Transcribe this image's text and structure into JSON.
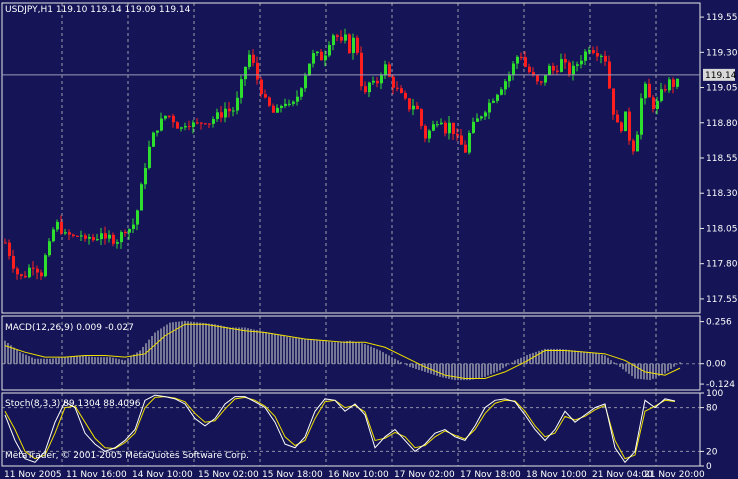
{
  "colors": {
    "background": "#141456",
    "frame": "#e8e8e8",
    "grid": "#c8c8c8",
    "bull": "#2ee02e",
    "bear": "#ff1e1e",
    "macd_hist": "#d8d8d8",
    "signal": "#f0e000",
    "stoch_main": "#ffffff",
    "stoch_signal": "#f0e000",
    "price_label_bg": "#d8d8d8",
    "price_label_text": "#000000"
  },
  "symbol_title": "USDJPY,H1  119.10 119.14 119.09 119.14",
  "current_price_label": "119.14",
  "macd_title": "MACD(12,26,9) 0.009 -0.027",
  "stoch_title": "Stoch(8,3,3) 89.1304 88.4096",
  "copyright": "MetaTrader, © 2001-2005 MetaQuotes Software Corp.",
  "price_ticks": [
    "119.55",
    "119.30",
    "119.05",
    "118.80",
    "118.55",
    "118.30",
    "118.05",
    "117.80",
    "117.55"
  ],
  "macd_ticks": [
    "0.256",
    "0.00",
    "-0.124"
  ],
  "stoch_ticks": [
    "100",
    "80",
    "20",
    "0"
  ],
  "time_labels": [
    "11 Nov 2005",
    "11 Nov 16:00",
    "14 Nov 10:00",
    "15 Nov 02:00",
    "15 Nov 18:00",
    "16 Nov 10:00",
    "17 Nov 02:00",
    "17 Nov 18:00",
    "18 Nov 10:00",
    "21 Nov 04:00",
    "21 Nov 20:00"
  ],
  "chart_data": {
    "type": "candlestick",
    "symbol": "USDJPY",
    "timeframe": "H1",
    "last_bar": {
      "open": 119.1,
      "high": 119.14,
      "low": 119.09,
      "close": 119.14
    },
    "price_range": [
      117.45,
      119.65
    ],
    "macd": {
      "fast": 12,
      "slow": 26,
      "signal": 9,
      "main": 0.009,
      "signal_value": -0.027,
      "range": [
        -0.16,
        0.29
      ]
    },
    "stochastic": {
      "k": 8,
      "d": 3,
      "slowing": 3,
      "main": 89.1304,
      "signal": 88.4096,
      "levels": [
        80,
        20
      ],
      "range": [
        0,
        100
      ]
    },
    "price_path": [
      [
        0,
        117.95
      ],
      [
        5,
        117.85
      ],
      [
        10,
        117.75
      ],
      [
        15,
        117.7
      ],
      [
        20,
        117.72
      ],
      [
        25,
        117.78
      ],
      [
        30,
        117.8
      ],
      [
        35,
        117.7
      ],
      [
        40,
        117.85
      ],
      [
        45,
        117.95
      ],
      [
        50,
        118.1
      ],
      [
        55,
        118.05
      ],
      [
        60,
        118.0
      ],
      [
        65,
        118.0
      ],
      [
        70,
        117.98
      ],
      [
        75,
        118.02
      ],
      [
        80,
        117.95
      ],
      [
        85,
        118.0
      ],
      [
        90,
        117.95
      ],
      [
        95,
        118.05
      ],
      [
        100,
        117.95
      ],
      [
        105,
        118.0
      ],
      [
        110,
        117.95
      ],
      [
        115,
        118.0
      ],
      [
        120,
        118.05
      ],
      [
        125,
        118.05
      ],
      [
        130,
        118.1
      ],
      [
        135,
        118.3
      ],
      [
        140,
        118.5
      ],
      [
        145,
        118.65
      ],
      [
        150,
        118.75
      ],
      [
        155,
        118.8
      ],
      [
        160,
        118.85
      ],
      [
        165,
        118.85
      ],
      [
        170,
        118.8
      ],
      [
        175,
        118.75
      ],
      [
        180,
        118.8
      ],
      [
        185,
        118.8
      ],
      [
        190,
        118.78
      ],
      [
        195,
        118.8
      ],
      [
        200,
        118.82
      ],
      [
        205,
        118.8
      ],
      [
        210,
        118.85
      ],
      [
        215,
        118.85
      ],
      [
        220,
        118.9
      ],
      [
        225,
        118.88
      ],
      [
        230,
        118.9
      ],
      [
        235,
        119.05
      ],
      [
        240,
        119.2
      ],
      [
        245,
        119.3
      ],
      [
        250,
        119.15
      ],
      [
        255,
        119.05
      ],
      [
        260,
        118.95
      ],
      [
        265,
        118.9
      ],
      [
        270,
        118.85
      ],
      [
        275,
        118.92
      ],
      [
        280,
        118.95
      ],
      [
        285,
        118.9
      ],
      [
        290,
        118.95
      ],
      [
        295,
        119.05
      ],
      [
        300,
        119.15
      ],
      [
        305,
        119.25
      ],
      [
        310,
        119.3
      ],
      [
        315,
        119.25
      ],
      [
        320,
        119.3
      ],
      [
        325,
        119.4
      ],
      [
        330,
        119.45
      ],
      [
        335,
        119.35
      ],
      [
        340,
        119.4
      ],
      [
        345,
        119.3
      ],
      [
        350,
        119.45
      ],
      [
        355,
        119.1
      ],
      [
        360,
        119.0
      ],
      [
        365,
        119.1
      ],
      [
        370,
        119.05
      ],
      [
        375,
        119.15
      ],
      [
        380,
        119.2
      ],
      [
        385,
        119.1
      ],
      [
        390,
        119.05
      ],
      [
        395,
        119.0
      ],
      [
        400,
        118.95
      ],
      [
        405,
        118.9
      ],
      [
        410,
        118.95
      ],
      [
        415,
        118.8
      ],
      [
        420,
        118.7
      ],
      [
        425,
        118.75
      ],
      [
        430,
        118.8
      ],
      [
        435,
        118.85
      ],
      [
        440,
        118.75
      ],
      [
        445,
        118.8
      ],
      [
        450,
        118.7
      ],
      [
        455,
        118.65
      ],
      [
        460,
        118.6
      ],
      [
        465,
        118.75
      ],
      [
        470,
        118.8
      ],
      [
        475,
        118.85
      ],
      [
        480,
        118.9
      ],
      [
        485,
        118.95
      ],
      [
        490,
        119.0
      ],
      [
        495,
        119.05
      ],
      [
        500,
        119.1
      ],
      [
        505,
        119.15
      ],
      [
        510,
        119.25
      ],
      [
        515,
        119.3
      ],
      [
        520,
        119.2
      ],
      [
        525,
        119.15
      ],
      [
        530,
        119.1
      ],
      [
        535,
        119.05
      ],
      [
        540,
        119.15
      ],
      [
        545,
        119.2
      ],
      [
        550,
        119.15
      ],
      [
        555,
        119.25
      ],
      [
        560,
        119.2
      ],
      [
        565,
        119.15
      ],
      [
        570,
        119.2
      ],
      [
        575,
        119.25
      ],
      [
        580,
        119.3
      ],
      [
        585,
        119.35
      ],
      [
        590,
        119.3
      ],
      [
        595,
        119.3
      ],
      [
        600,
        119.25
      ],
      [
        605,
        119.0
      ],
      [
        610,
        118.8
      ],
      [
        615,
        118.75
      ],
      [
        620,
        118.85
      ],
      [
        625,
        118.65
      ],
      [
        630,
        118.6
      ],
      [
        635,
        118.95
      ],
      [
        640,
        119.05
      ],
      [
        645,
        118.95
      ],
      [
        650,
        118.9
      ],
      [
        655,
        119.0
      ],
      [
        660,
        119.05
      ],
      [
        665,
        119.1
      ],
      [
        670,
        119.05
      ],
      [
        675,
        119.14
      ]
    ],
    "macd_signal_path": [
      [
        0,
        0.11
      ],
      [
        20,
        0.07
      ],
      [
        40,
        0.04
      ],
      [
        60,
        0.04
      ],
      [
        80,
        0.05
      ],
      [
        100,
        0.05
      ],
      [
        120,
        0.04
      ],
      [
        140,
        0.06
      ],
      [
        160,
        0.17
      ],
      [
        180,
        0.24
      ],
      [
        200,
        0.24
      ],
      [
        220,
        0.22
      ],
      [
        240,
        0.2
      ],
      [
        260,
        0.19
      ],
      [
        280,
        0.17
      ],
      [
        300,
        0.15
      ],
      [
        320,
        0.14
      ],
      [
        340,
        0.13
      ],
      [
        360,
        0.13
      ],
      [
        380,
        0.1
      ],
      [
        400,
        0.04
      ],
      [
        420,
        -0.02
      ],
      [
        440,
        -0.07
      ],
      [
        460,
        -0.09
      ],
      [
        480,
        -0.09
      ],
      [
        500,
        -0.05
      ],
      [
        520,
        0.01
      ],
      [
        540,
        0.08
      ],
      [
        560,
        0.08
      ],
      [
        580,
        0.07
      ],
      [
        600,
        0.06
      ],
      [
        620,
        0.02
      ],
      [
        640,
        -0.05
      ],
      [
        660,
        -0.07
      ],
      [
        675,
        -0.027
      ]
    ],
    "macd_hist": [
      [
        0,
        0.14
      ],
      [
        15,
        0.07
      ],
      [
        30,
        0.03
      ],
      [
        45,
        0.03
      ],
      [
        60,
        0.04
      ],
      [
        75,
        0.05
      ],
      [
        90,
        0.04
      ],
      [
        105,
        0.04
      ],
      [
        120,
        0.02
      ],
      [
        135,
        0.08
      ],
      [
        150,
        0.19
      ],
      [
        165,
        0.25
      ],
      [
        180,
        0.26
      ],
      [
        195,
        0.25
      ],
      [
        210,
        0.24
      ],
      [
        225,
        0.22
      ],
      [
        240,
        0.22
      ],
      [
        255,
        0.2
      ],
      [
        270,
        0.18
      ],
      [
        285,
        0.16
      ],
      [
        300,
        0.15
      ],
      [
        315,
        0.14
      ],
      [
        330,
        0.13
      ],
      [
        345,
        0.14
      ],
      [
        360,
        0.12
      ],
      [
        375,
        0.08
      ],
      [
        390,
        0.03
      ],
      [
        405,
        -0.02
      ],
      [
        420,
        -0.05
      ],
      [
        435,
        -0.08
      ],
      [
        450,
        -0.1
      ],
      [
        465,
        -0.1
      ],
      [
        480,
        -0.08
      ],
      [
        495,
        -0.04
      ],
      [
        510,
        0.02
      ],
      [
        525,
        0.06
      ],
      [
        540,
        0.09
      ],
      [
        555,
        0.09
      ],
      [
        570,
        0.08
      ],
      [
        585,
        0.07
      ],
      [
        600,
        0.05
      ],
      [
        615,
        -0.02
      ],
      [
        630,
        -0.09
      ],
      [
        645,
        -0.1
      ],
      [
        660,
        -0.06
      ],
      [
        675,
        0.009
      ]
    ],
    "stoch_main_path": [
      [
        0,
        70
      ],
      [
        10,
        35
      ],
      [
        20,
        10
      ],
      [
        30,
        5
      ],
      [
        40,
        20
      ],
      [
        50,
        60
      ],
      [
        60,
        88
      ],
      [
        70,
        80
      ],
      [
        80,
        45
      ],
      [
        90,
        30
      ],
      [
        100,
        20
      ],
      [
        110,
        25
      ],
      [
        120,
        35
      ],
      [
        130,
        50
      ],
      [
        140,
        90
      ],
      [
        150,
        97
      ],
      [
        160,
        95
      ],
      [
        170,
        92
      ],
      [
        180,
        85
      ],
      [
        190,
        65
      ],
      [
        200,
        55
      ],
      [
        210,
        65
      ],
      [
        220,
        85
      ],
      [
        230,
        95
      ],
      [
        240,
        95
      ],
      [
        250,
        88
      ],
      [
        260,
        80
      ],
      [
        270,
        60
      ],
      [
        280,
        30
      ],
      [
        290,
        25
      ],
      [
        300,
        40
      ],
      [
        310,
        75
      ],
      [
        320,
        92
      ],
      [
        330,
        90
      ],
      [
        340,
        75
      ],
      [
        350,
        85
      ],
      [
        360,
        70
      ],
      [
        370,
        25
      ],
      [
        380,
        40
      ],
      [
        390,
        50
      ],
      [
        400,
        35
      ],
      [
        410,
        20
      ],
      [
        420,
        30
      ],
      [
        430,
        45
      ],
      [
        440,
        50
      ],
      [
        450,
        40
      ],
      [
        460,
        35
      ],
      [
        470,
        55
      ],
      [
        480,
        80
      ],
      [
        490,
        90
      ],
      [
        500,
        92
      ],
      [
        510,
        88
      ],
      [
        520,
        70
      ],
      [
        530,
        50
      ],
      [
        540,
        35
      ],
      [
        550,
        50
      ],
      [
        560,
        75
      ],
      [
        570,
        60
      ],
      [
        580,
        70
      ],
      [
        590,
        80
      ],
      [
        600,
        85
      ],
      [
        610,
        25
      ],
      [
        620,
        5
      ],
      [
        630,
        20
      ],
      [
        640,
        90
      ],
      [
        650,
        80
      ],
      [
        660,
        92
      ],
      [
        670,
        89
      ]
    ],
    "stoch_signal_path": [
      [
        0,
        75
      ],
      [
        10,
        50
      ],
      [
        20,
        20
      ],
      [
        30,
        10
      ],
      [
        40,
        15
      ],
      [
        50,
        45
      ],
      [
        60,
        80
      ],
      [
        70,
        82
      ],
      [
        80,
        60
      ],
      [
        90,
        38
      ],
      [
        100,
        25
      ],
      [
        110,
        24
      ],
      [
        120,
        32
      ],
      [
        130,
        45
      ],
      [
        140,
        80
      ],
      [
        150,
        94
      ],
      [
        160,
        95
      ],
      [
        170,
        93
      ],
      [
        180,
        88
      ],
      [
        190,
        72
      ],
      [
        200,
        60
      ],
      [
        210,
        62
      ],
      [
        220,
        78
      ],
      [
        230,
        92
      ],
      [
        240,
        94
      ],
      [
        250,
        90
      ],
      [
        260,
        82
      ],
      [
        270,
        68
      ],
      [
        280,
        40
      ],
      [
        290,
        28
      ],
      [
        300,
        35
      ],
      [
        310,
        65
      ],
      [
        320,
        88
      ],
      [
        330,
        90
      ],
      [
        340,
        80
      ],
      [
        350,
        83
      ],
      [
        360,
        74
      ],
      [
        370,
        35
      ],
      [
        380,
        38
      ],
      [
        390,
        46
      ],
      [
        400,
        40
      ],
      [
        410,
        25
      ],
      [
        420,
        28
      ],
      [
        430,
        40
      ],
      [
        440,
        48
      ],
      [
        450,
        42
      ],
      [
        460,
        37
      ],
      [
        470,
        50
      ],
      [
        480,
        72
      ],
      [
        490,
        86
      ],
      [
        500,
        90
      ],
      [
        510,
        89
      ],
      [
        520,
        75
      ],
      [
        530,
        55
      ],
      [
        540,
        40
      ],
      [
        550,
        45
      ],
      [
        560,
        68
      ],
      [
        570,
        63
      ],
      [
        580,
        68
      ],
      [
        590,
        77
      ],
      [
        600,
        83
      ],
      [
        610,
        35
      ],
      [
        620,
        10
      ],
      [
        630,
        15
      ],
      [
        640,
        75
      ],
      [
        650,
        82
      ],
      [
        660,
        90
      ],
      [
        670,
        88.4
      ]
    ]
  }
}
